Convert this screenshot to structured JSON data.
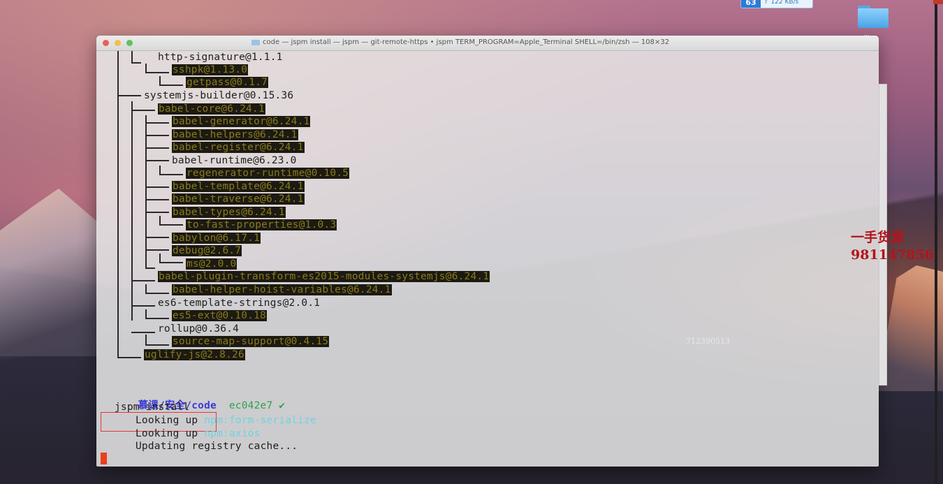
{
  "desktop": {
    "net_widget": {
      "badge": "63",
      "speed": "↑ 122 KB/s"
    },
    "folder_label": "..."
  },
  "terminal": {
    "title": "code — jspm install — jspm — git-remote-https • jspm TERM_PROGRAM=Apple_Terminal SHELL=/bin/zsh — 108×32",
    "lines": {
      "l1": "http-signature@1.1.1",
      "l2": "sshpk@1.13.0",
      "l3": "getpass@0.1.7",
      "l4": "systemjs-builder@0.15.36",
      "l5": "babel-core@6.24.1",
      "l6": "babel-generator@6.24.1",
      "l7": "babel-helpers@6.24.1",
      "l8": "babel-register@6.24.1",
      "l9": "babel-runtime@6.23.0",
      "l10": "regenerator-runtime@0.10.5",
      "l11": "babel-template@6.24.1",
      "l12": "babel-traverse@6.24.1",
      "l13": "babel-types@6.24.1",
      "l14": "to-fast-properties@1.0.3",
      "l15": "babylon@6.17.1",
      "l16": "debug@2.6.7",
      "l17": "ms@2.0.0",
      "l18": "babel-plugin-transform-es2015-modules-systemjs@6.24.1",
      "l19": "babel-helper-hoist-variables@6.24.1",
      "l20": "es6-template-strings@2.0.1",
      "l21": "es5-ext@0.10.18",
      "l22": "rollup@0.36.4",
      "l23": "source-map-support@0.4.15",
      "l24": "uglify-js@2.8.26"
    },
    "prompt": {
      "path": "慕课/安全/code",
      "git": "ec042e7 ✔"
    },
    "command": "jspm install",
    "output": [
      {
        "prefix": "Looking up",
        "pkg": "npm:form-serialize"
      },
      {
        "prefix": "Looking up",
        "pkg": "npm:axios"
      },
      {
        "prefix": "Updating registry cache...",
        "pkg": ""
      }
    ]
  },
  "watermark": {
    "line1": "一手货源",
    "line2": "981147856",
    "code": "712390513"
  },
  "colors": {
    "highlight_bg": "#1c1a12",
    "highlight_fg": "#8a7a1d",
    "prompt_path": "#3b3bd6",
    "prompt_git": "#2da44e",
    "npm_pkg": "#6fd3e0",
    "cursor": "#e8401c"
  }
}
